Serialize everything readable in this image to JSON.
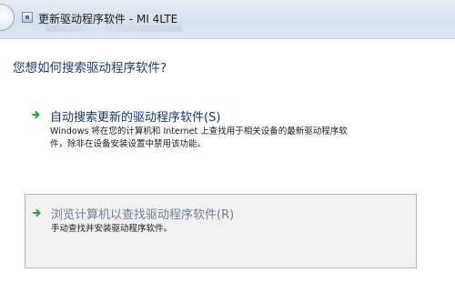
{
  "window": {
    "title": "更新驱动程序软件 - MI 4LTE",
    "back_icon": "back-arrow-icon",
    "device_icon": "device-manager-icon"
  },
  "question": "您想如何搜索驱动程序软件?",
  "options": [
    {
      "title": "自动搜索更新的驱动程序软件(S)",
      "description_lines": [
        "Windows 将在您的计算机和 Internet 上查找用于相关设备的最新驱动程序软",
        "件，除非在设备安装设置中禁用该功能。"
      ],
      "icon": "green-arrow-icon"
    },
    {
      "title": "浏览计算机以查找驱动程序软件(R)",
      "description_lines": [
        "手动查找并安装驱动程序软件。"
      ],
      "icon": "green-arrow-icon"
    }
  ],
  "colors": {
    "accent_text": "#15356e",
    "arrow": "#2e9a3a",
    "selected_bg": "#f1f1f1"
  }
}
